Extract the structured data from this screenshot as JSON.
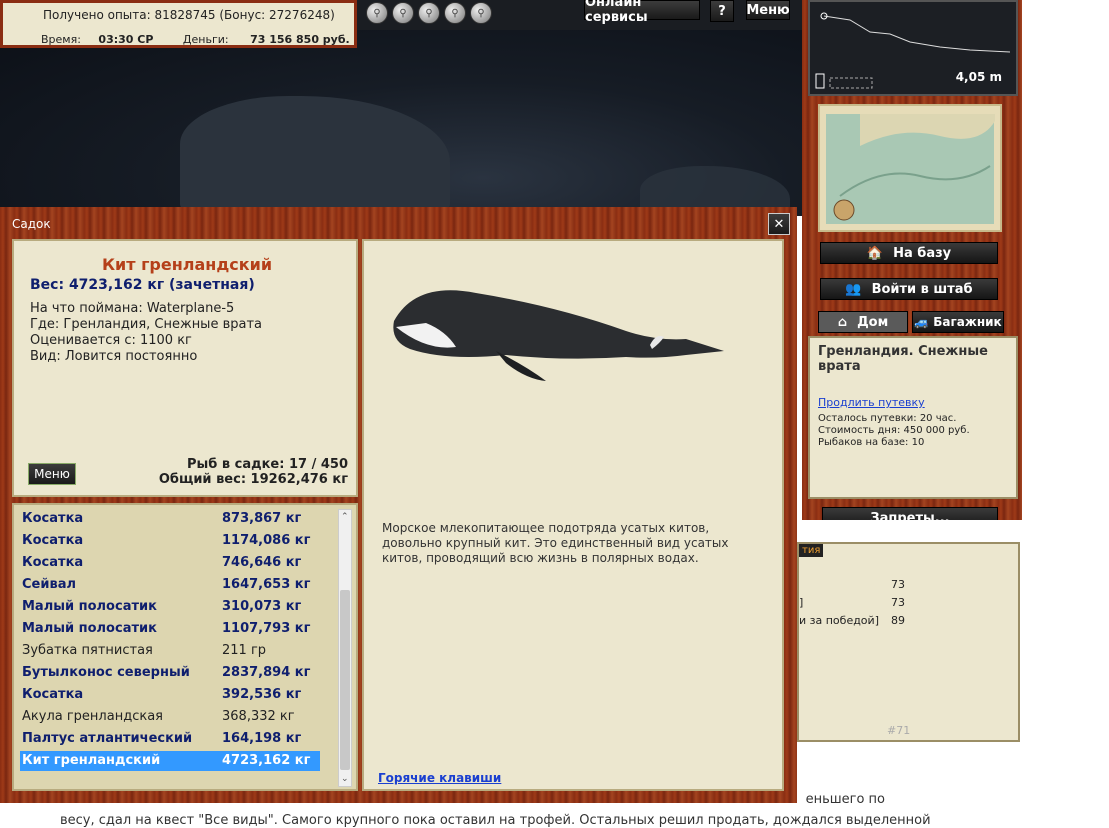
{
  "stats": {
    "experience": "Получено опыта: 81828745 (Бонус: 27276248)",
    "time_label": "Время:",
    "time_value": "03:30 СР",
    "money_label": "Деньги:",
    "money_value": "73 156 850 руб."
  },
  "top_buttons": {
    "online": "Онлайн сервисы",
    "help": "?",
    "menu": "Меню"
  },
  "depth": {
    "value": "4,05 m"
  },
  "nav": {
    "to_base": "На базу",
    "to_hq": "Войти в штаб",
    "home_tab": "Дом",
    "trunk_tab": "Багажник",
    "bans": "Запреты..."
  },
  "location": {
    "name": "Гренландия. Снежные врата",
    "extend_link": "Продлить путевку",
    "remaining": "Осталось путевки: 20 час.",
    "day_cost": "Стоимость дня: 450 000 руб.",
    "fishers": "Рыбаков на базе: 10"
  },
  "modal": {
    "title": "Садок",
    "close": "✕",
    "fish_name": "Кит гренландский",
    "fish_weight": "Вес: 4723,162 кг (зачетная)",
    "caught_with": "На что поймана: Waterplane-5",
    "where": "Где: Гренландия, Снежные врата",
    "valued_from": "Оценивается с: 1100 кг",
    "kind": "Вид: Ловится постоянно",
    "menu_button": "Меню",
    "count": "Рыб в садке: 17 / 450",
    "total_weight": "Общий вес: 19262,476 кг",
    "description": "Морское млекопитающее подотряда усатых китов, довольно крупный кит. Это единственный вид усатых китов, проводящий всю жизнь в полярных водах.",
    "hotkeys": "Горячие клавиши"
  },
  "catch_list": [
    {
      "name": "Косатка",
      "weight": "873,867 кг",
      "bold": true
    },
    {
      "name": "Косатка",
      "weight": "1174,086 кг",
      "bold": true
    },
    {
      "name": "Косатка",
      "weight": "746,646 кг",
      "bold": true
    },
    {
      "name": "Сейвал",
      "weight": "1647,653 кг",
      "bold": true
    },
    {
      "name": "Малый полосатик",
      "weight": "310,073 кг",
      "bold": true
    },
    {
      "name": "Малый полосатик",
      "weight": "1107,793 кг",
      "bold": true
    },
    {
      "name": "Зубатка пятнистая",
      "weight": "211 гр",
      "bold": false
    },
    {
      "name": "Бутылконос северный",
      "weight": "2837,894 кг",
      "bold": true
    },
    {
      "name": "Косатка",
      "weight": "392,536 кг",
      "bold": true
    },
    {
      "name": "Акула гренландская",
      "weight": "368,332 кг",
      "bold": false
    },
    {
      "name": "Палтус атлантический",
      "weight": "164,198 кг",
      "bold": true
    },
    {
      "name": "Кит гренландский",
      "weight": "4723,162 кг",
      "bold": true,
      "selected": true
    }
  ],
  "background": {
    "tab_fragment": "тия",
    "rows": [
      {
        "text": "",
        "num": "73"
      },
      {
        "text": "]",
        "num": "73"
      },
      {
        "text": "и за победой]",
        "num": "89"
      }
    ],
    "post_id": "#71",
    "text_line1": "еньшего по",
    "text_line2": "весу, сдал на квест \"Все виды\". Самого крупного пока оставил на трофей. Остальных решил продать, дождался выделенной"
  },
  "colors": {
    "wood": "#8a2d12",
    "parchment": "#ece7cf",
    "title_red": "#b5401a",
    "navy": "#0f1f6e",
    "selection": "#3399ff"
  }
}
